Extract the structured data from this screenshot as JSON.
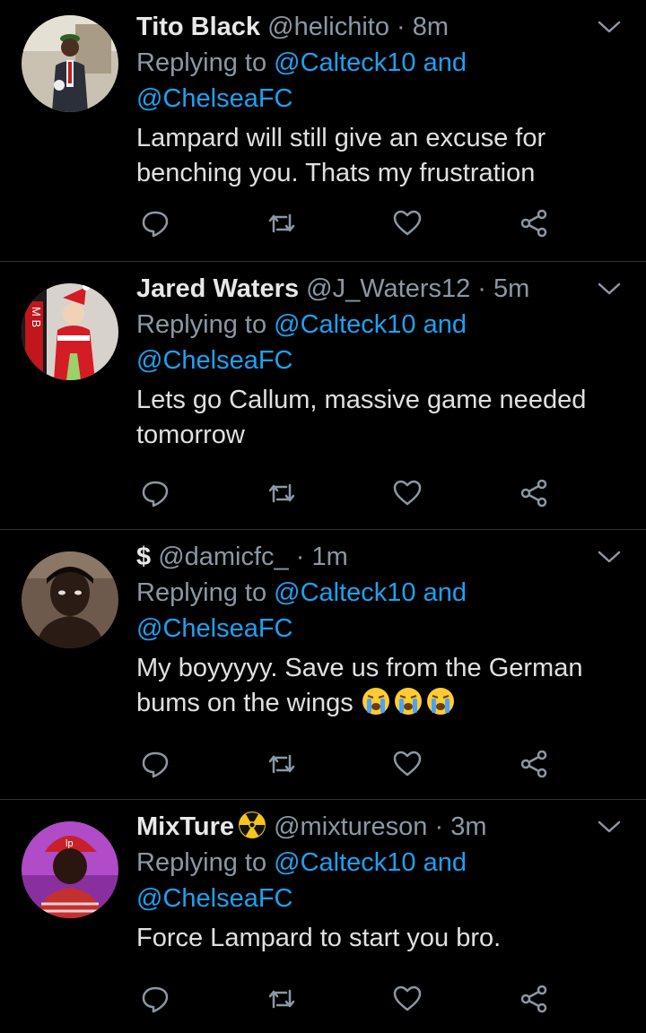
{
  "tweets": [
    {
      "name": "Tito Black",
      "handle": "@helichito",
      "separator": "·",
      "time": "8m",
      "replying_prefix": "Replying to",
      "reply_user1": "@Calteck10",
      "reply_and": "and",
      "reply_user2": "@ChelseaFC",
      "text_line1": "Lampard will still give an excuse for",
      "text_line2": "benching you. Thats my frustration",
      "avatar": "avatar-tito-black"
    },
    {
      "name": "Jared Waters",
      "handle": "@J_Waters12",
      "separator": "·",
      "time": "5m",
      "replying_prefix": "Replying to",
      "reply_user1": "@Calteck10",
      "reply_and": "and",
      "reply_user2": "@ChelseaFC",
      "text_line1": "Lets go Callum, massive game needed",
      "text_line2": "tomorrow",
      "avatar": "avatar-jared-waters"
    },
    {
      "name": "$",
      "handle": "@damicfc_",
      "separator": "·",
      "time": "1m",
      "replying_prefix": "Replying to",
      "reply_user1": "@Calteck10",
      "reply_and": "and",
      "reply_user2": "@ChelseaFC",
      "text_line1": "My boyyyyy. Save us from the German",
      "text_line2": "bums on the wings",
      "emojis": [
        "crying-face-emoji",
        "crying-face-emoji",
        "crying-face-emoji"
      ],
      "avatar": "avatar-damicfc"
    },
    {
      "name": "MixTure",
      "badge": "radioactive-icon",
      "handle": "@mixtureson",
      "separator": "·",
      "time": "3m",
      "replying_prefix": "Replying to",
      "reply_user1": "@Calteck10",
      "reply_and": "and",
      "reply_user2": "@ChelseaFC",
      "text_line1": "Force Lampard to start you bro.",
      "avatar": "avatar-mixtureson"
    }
  ],
  "colors": {
    "background": "#000000",
    "text": "#e0e0e0",
    "muted": "#8b98a5",
    "link": "#1da1f2",
    "divider": "#2f3336",
    "radioactive": "#f5c518"
  },
  "icons": [
    "reply-icon",
    "retweet-icon",
    "like-icon",
    "share-icon",
    "chevron-down-icon"
  ]
}
